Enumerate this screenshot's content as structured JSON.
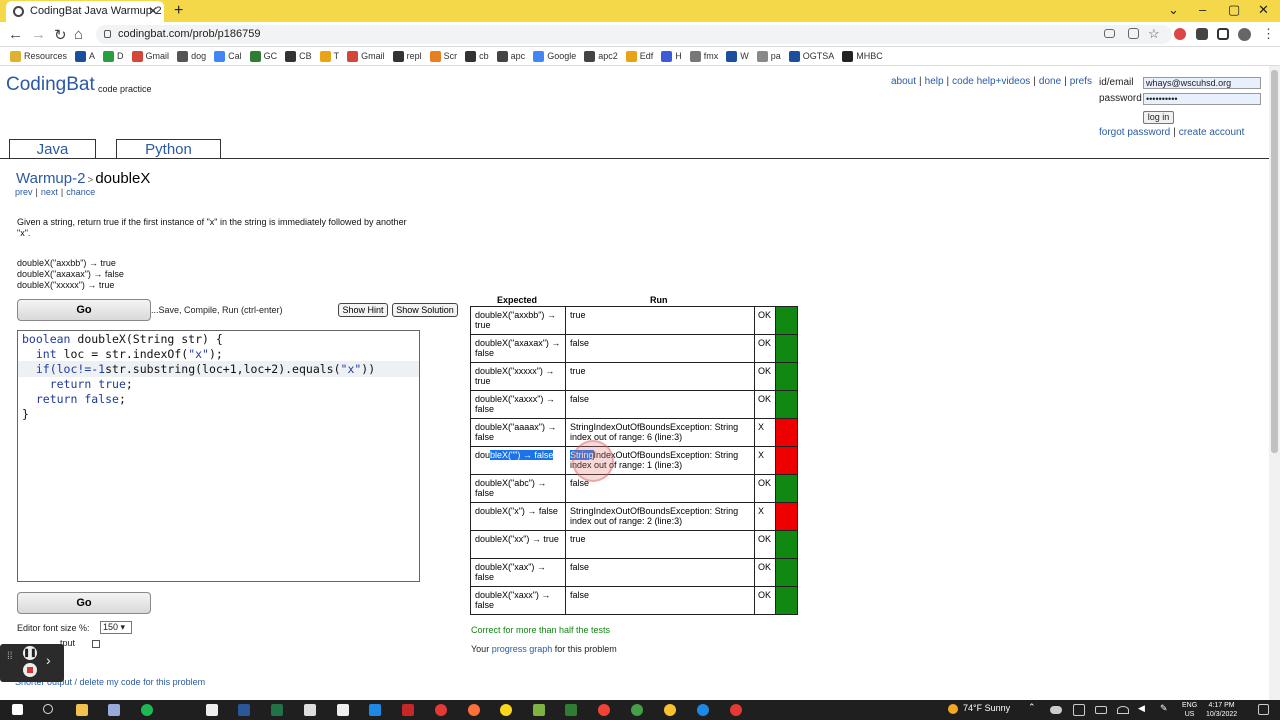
{
  "browser": {
    "tab_title": "CodingBat Java Warmup-2 doubleX",
    "url": "codingbat.com/prob/p186759",
    "bookmarks": [
      {
        "label": "Resources",
        "color": "#e0b030"
      },
      {
        "label": "A",
        "color": "#1a4fa0"
      },
      {
        "label": "D",
        "color": "#2a9d3c"
      },
      {
        "label": "Gmail",
        "color": "#d44638"
      },
      {
        "label": "dog",
        "color": "#555"
      },
      {
        "label": "Cal",
        "color": "#4285f4"
      },
      {
        "label": "GC",
        "color": "#2e7d32"
      },
      {
        "label": "CB",
        "color": "#333"
      },
      {
        "label": "T",
        "color": "#e8a317"
      },
      {
        "label": "Gmail",
        "color": "#d44638"
      },
      {
        "label": "repl",
        "color": "#333"
      },
      {
        "label": "Scr",
        "color": "#e67e22"
      },
      {
        "label": "cb",
        "color": "#333"
      },
      {
        "label": "apc",
        "color": "#444"
      },
      {
        "label": "Google",
        "color": "#4285f4"
      },
      {
        "label": "apc2",
        "color": "#444"
      },
      {
        "label": "Edf",
        "color": "#e8a317"
      },
      {
        "label": "H",
        "color": "#3b5bdb"
      },
      {
        "label": "fmx",
        "color": "#777"
      },
      {
        "label": "W",
        "color": "#1a4fa0"
      },
      {
        "label": "pa",
        "color": "#888"
      },
      {
        "label": "OGTSA",
        "color": "#1a4fa0"
      },
      {
        "label": "MHBC",
        "color": "#222"
      }
    ]
  },
  "site": {
    "logo": "CodingBat",
    "logo_sub": "code practice",
    "toplinks": [
      "about",
      "help",
      "code help+videos",
      "done",
      "prefs"
    ],
    "login": {
      "id_label": "id/email",
      "id_value": "whays@wscuhsd.org",
      "password_label": "password",
      "password_value": "••••••••••",
      "login_button": "log in",
      "forgot": "forgot password",
      "create": "create account"
    },
    "lang_tabs": [
      "Java",
      "Python"
    ]
  },
  "problem": {
    "section": "Warmup-2",
    "arrow": ">",
    "name": "doubleX",
    "nav": [
      "prev",
      "next",
      "chance"
    ],
    "description": "Given a string, return true if the first instance of \"x\" in the string is immediately followed by another \"x\".",
    "examples": [
      "doubleX(\"axxbb\") → true",
      "doubleX(\"axaxax\") → false",
      "doubleX(\"xxxxx\") → true"
    ],
    "go_label": "Go",
    "go_note": "...Save, Compile, Run (ctrl-enter)",
    "hint_label": "Show Hint",
    "solution_label": "Show Solution",
    "font_size_label": "Editor font size %:",
    "font_size_value": "150",
    "short_output_label": "tput",
    "delete_link": "Shorter output / delete my code for this problem"
  },
  "code": {
    "l1_kw": "boolean",
    "l1_rest": " doubleX(String str) {",
    "l2_kw": "int",
    "l2_rest": " loc = str.indexOf(",
    "l2_str": "\"x\"",
    "l2_end": ");",
    "l3_a": "if(loc!=-1",
    "l3_b": "str.substring(loc+1,loc+2).equals(",
    "l3_str": "\"x\"",
    "l3_end": "))",
    "l4_kw": "return",
    "l4_val": "true",
    "l4_end": ";",
    "l5_kw": "return",
    "l5_val": "false",
    "l5_end": ";",
    "l6": "}"
  },
  "results": {
    "header_expected": "Expected",
    "header_run": "Run",
    "rows": [
      {
        "expected": "doubleX(\"axxbb\") → true",
        "run": "true",
        "status": "OK",
        "color": "green"
      },
      {
        "expected": "doubleX(\"axaxax\") → false",
        "run": "false",
        "status": "OK",
        "color": "green"
      },
      {
        "expected": "doubleX(\"xxxxx\") → true",
        "run": "true",
        "status": "OK",
        "color": "green"
      },
      {
        "expected": "doubleX(\"xaxxx\") → false",
        "run": "false",
        "status": "OK",
        "color": "green"
      },
      {
        "expected": "doubleX(\"aaaax\") → false",
        "run": "StringIndexOutOfBoundsException: String index out of range: 6 (line:3)",
        "status": "X",
        "color": "red"
      },
      {
        "expected_pre": "dou",
        "expected_hl": "bleX(\"\") → false",
        "run_hl": "String",
        "run_rest": "IndexOutOfBoundsException: String index out of range: 1 (line:3)",
        "status": "X",
        "color": "red"
      },
      {
        "expected": "doubleX(\"abc\") → false",
        "run": "false",
        "status": "OK",
        "color": "green"
      },
      {
        "expected": "doubleX(\"x\") → false",
        "run": "StringIndexOutOfBoundsException: String index out of range: 2 (line:3)",
        "status": "X",
        "color": "red"
      },
      {
        "expected": "doubleX(\"xx\") → true",
        "run": "true",
        "status": "OK",
        "color": "green"
      },
      {
        "expected": "doubleX(\"xax\") → false",
        "run": "false",
        "status": "OK",
        "color": "green"
      },
      {
        "expected": "doubleX(\"xaxx\") → false",
        "run": "false",
        "status": "OK",
        "color": "green"
      }
    ],
    "summary": "Correct for more than half the tests",
    "progress_pre": "Your ",
    "progress_link": "progress graph",
    "progress_post": " for this problem"
  },
  "taskbar": {
    "weather": "74°F  Sunny",
    "lang_top": "ENG",
    "lang_bottom": "US",
    "time": "4:17 PM",
    "date": "10/3/2022"
  },
  "colors": {
    "ok": "#118811",
    "fail": "#ee0000",
    "link": "#2a5aa5"
  }
}
